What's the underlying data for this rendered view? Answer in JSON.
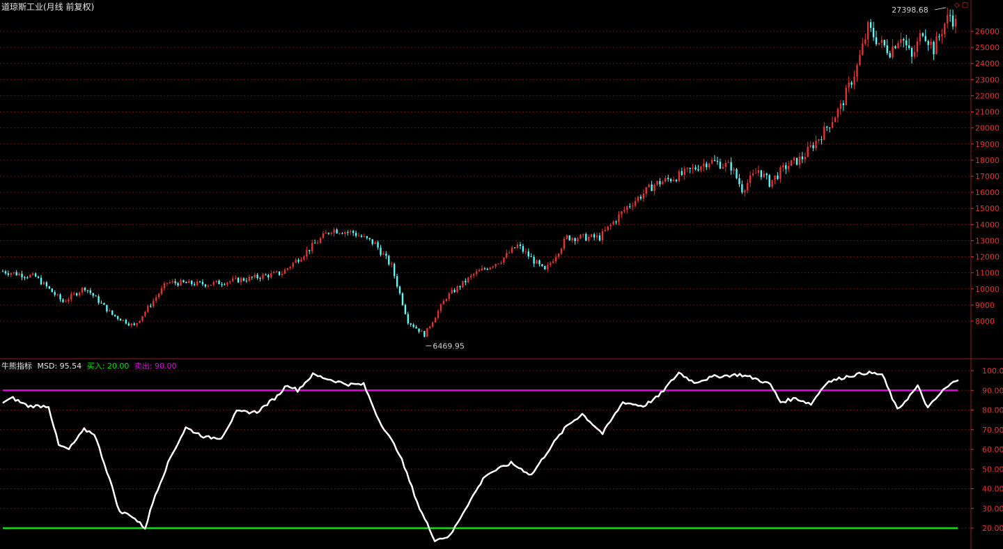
{
  "colors": {
    "up": "#e8322f",
    "down": "#54ffff",
    "grid": "#6e1111",
    "frame": "#8c1c1c",
    "msd_line": "#ffffff",
    "buy_line": "#00e600",
    "sell_line": "#e600e6",
    "axis_text": "#e8322f"
  },
  "header": {
    "title": "道琼斯工业(月线 前复权)",
    "icons": [
      "diamond-icon",
      "square-icon"
    ]
  },
  "indicator_legend": {
    "name": "牛熊指标",
    "msd_label": "MSD: 95.54",
    "buy_label": "买入: 20.00",
    "sell_label": "卖出: 90.00"
  },
  "chart_data": [
    {
      "type": "candlestick",
      "title": "道琼斯工业(月线 前复权)",
      "ylim": [
        6000,
        27600
      ],
      "y_ticks": [
        8000,
        9000,
        10000,
        11000,
        12000,
        13000,
        14000,
        15000,
        16000,
        17000,
        18000,
        19000,
        20000,
        21000,
        22000,
        23000,
        24000,
        25000,
        26000
      ],
      "annotations": [
        {
          "text": "27398.68",
          "value": 27398.68,
          "marker": "max"
        },
        {
          "text": "6469.95",
          "value": 6469.95,
          "marker": "min"
        }
      ],
      "close_path_keypoints": [
        [
          0,
          11100
        ],
        [
          12,
          10750
        ],
        [
          22,
          9200
        ],
        [
          30,
          10100
        ],
        [
          40,
          8400
        ],
        [
          48,
          7700
        ],
        [
          60,
          10400
        ],
        [
          75,
          10300
        ],
        [
          90,
          10650
        ],
        [
          102,
          11000
        ],
        [
          110,
          12200
        ],
        [
          120,
          13700
        ],
        [
          128,
          13500
        ],
        [
          136,
          12800
        ],
        [
          142,
          11400
        ],
        [
          148,
          8000
        ],
        [
          154,
          7150
        ],
        [
          162,
          9500
        ],
        [
          172,
          10900
        ],
        [
          182,
          11800
        ],
        [
          188,
          12700
        ],
        [
          198,
          11100
        ],
        [
          206,
          13200
        ],
        [
          218,
          13200
        ],
        [
          228,
          15100
        ],
        [
          238,
          16500
        ],
        [
          248,
          17100
        ],
        [
          258,
          17950
        ],
        [
          266,
          17600
        ],
        [
          270,
          16200
        ],
        [
          276,
          17400
        ],
        [
          280,
          16600
        ],
        [
          286,
          17600
        ],
        [
          292,
          18150
        ],
        [
          300,
          19800
        ],
        [
          306,
          21300
        ],
        [
          312,
          23800
        ],
        [
          316,
          26200
        ],
        [
          320,
          25300
        ],
        [
          324,
          24800
        ],
        [
          328,
          25800
        ],
        [
          332,
          24300
        ],
        [
          336,
          26100
        ],
        [
          340,
          24900
        ],
        [
          344,
          26500
        ],
        [
          346,
          27000
        ],
        [
          348,
          26500
        ]
      ],
      "candles": 349
    },
    {
      "type": "line",
      "series": [
        {
          "name": "MSD",
          "last": 95.54
        },
        {
          "name": "买入",
          "value": 20.0
        },
        {
          "name": "卖出",
          "value": 90.0
        }
      ],
      "ylim": [
        12,
        101
      ],
      "y_ticks": [
        20,
        30,
        40,
        50,
        60,
        70,
        80,
        90,
        100
      ],
      "msd_keypoints": [
        [
          0,
          84
        ],
        [
          4,
          86
        ],
        [
          10,
          82
        ],
        [
          16,
          82
        ],
        [
          18,
          82
        ],
        [
          22,
          62
        ],
        [
          26,
          60
        ],
        [
          32,
          70
        ],
        [
          36,
          68
        ],
        [
          42,
          45
        ],
        [
          46,
          28
        ],
        [
          50,
          27
        ],
        [
          56,
          20
        ],
        [
          60,
          37
        ],
        [
          66,
          56
        ],
        [
          72,
          71
        ],
        [
          80,
          66
        ],
        [
          86,
          66
        ],
        [
          92,
          79
        ],
        [
          100,
          79
        ],
        [
          108,
          87
        ],
        [
          112,
          93
        ],
        [
          116,
          90
        ],
        [
          122,
          98
        ],
        [
          130,
          95
        ],
        [
          136,
          93
        ],
        [
          142,
          93
        ],
        [
          148,
          75
        ],
        [
          156,
          58
        ],
        [
          164,
          30
        ],
        [
          170,
          14
        ],
        [
          176,
          16
        ],
        [
          182,
          30
        ],
        [
          190,
          47
        ],
        [
          200,
          53
        ],
        [
          208,
          47
        ],
        [
          216,
          62
        ],
        [
          222,
          72
        ],
        [
          228,
          78
        ],
        [
          236,
          68
        ],
        [
          244,
          84
        ],
        [
          252,
          82
        ],
        [
          258,
          87
        ],
        [
          266,
          99
        ],
        [
          272,
          94
        ],
        [
          280,
          97
        ],
        [
          290,
          98
        ],
        [
          296,
          96
        ],
        [
          302,
          93
        ],
        [
          306,
          84
        ],
        [
          312,
          86
        ],
        [
          318,
          83
        ],
        [
          324,
          94
        ],
        [
          332,
          97
        ],
        [
          340,
          99
        ],
        [
          346,
          98
        ],
        [
          352,
          80
        ],
        [
          360,
          92
        ],
        [
          364,
          81
        ],
        [
          370,
          90
        ],
        [
          376,
          96
        ]
      ]
    }
  ]
}
